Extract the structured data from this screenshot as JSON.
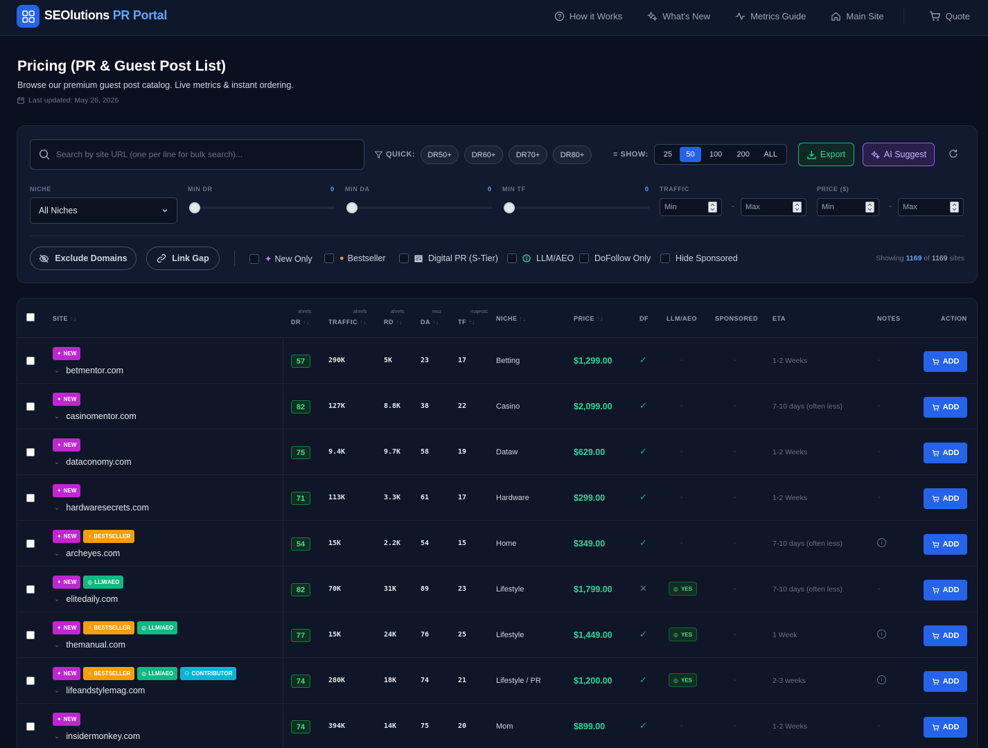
{
  "nav": {
    "brand_main": "SEOlutions",
    "brand_accent": "PR Portal",
    "links": [
      "How it Works",
      "What's New",
      "Metrics Guide",
      "Main Site"
    ],
    "quote": "Quote"
  },
  "header": {
    "title": "Pricing (PR & Guest Post List)",
    "subtitle": "Browse our premium guest post catalog. Live metrics & instant ordering.",
    "updated": "Last updated: May 26, 2026"
  },
  "filters": {
    "search_placeholder": "Search by site URL (one per line for bulk search)...",
    "quick_label": "QUICK:",
    "quick_pills": [
      "DR50+",
      "DR60+",
      "DR70+",
      "DR80+"
    ],
    "show_label": "SHOW:",
    "show_options": [
      "25",
      "50",
      "100",
      "200",
      "ALL"
    ],
    "show_selected": "50",
    "export_label": "Export",
    "ai_label": "AI Suggest",
    "niche_label": "NICHE",
    "niche_value": "All Niches",
    "min_dr_label": "MIN DR",
    "min_dr_value": "0",
    "min_da_label": "MIN DA",
    "min_da_value": "0",
    "min_tf_label": "MIN TF",
    "min_tf_value": "0",
    "traffic_label": "TRAFFIC",
    "price_label": "PRICE ($)",
    "min_placeholder": "Min",
    "max_placeholder": "Max",
    "range_sep": "-",
    "exclude_label": "Exclude Domains",
    "linkgap_label": "Link Gap",
    "checkboxes": [
      "New Only",
      "Bestseller",
      "Digital PR (S-Tier)",
      "LLM/AEO",
      "DoFollow Only",
      "Hide Sponsored"
    ],
    "showing_prefix": "Showing",
    "showing_count": "1169",
    "showing_of": "of",
    "showing_total": "1169",
    "showing_suffix": "sites"
  },
  "table": {
    "headers": {
      "site": "SITE",
      "dr": "DR",
      "dr_src": "ahrefs",
      "traffic": "TRAFFIC",
      "traffic_src": "ahrefs",
      "rd": "RD",
      "rd_src": "ahrefs",
      "da": "DA",
      "da_src": "moz",
      "tf": "TF",
      "tf_src": "majestic",
      "niche": "NICHE",
      "price": "PRICE",
      "df": "DF",
      "llm": "LLM/AEO",
      "sponsored": "SPONSORED",
      "eta": "ETA",
      "notes": "NOTES",
      "action": "ACTION"
    },
    "sort_glyph": "↑↓",
    "add_label": "ADD",
    "yes_label": "YES",
    "dash": "-",
    "rows": [
      {
        "badges": [
          "NEW"
        ],
        "site": "betmentor.com",
        "dr": "57",
        "traffic": "290K",
        "rd": "5K",
        "da": "23",
        "tf": "17",
        "niche": "Betting",
        "price": "$1,299.00",
        "df": true,
        "llm": false,
        "eta": "1-2 Weeks",
        "note": false
      },
      {
        "badges": [
          "NEW"
        ],
        "site": "casinomentor.com",
        "dr": "82",
        "traffic": "127K",
        "rd": "8.8K",
        "da": "38",
        "tf": "22",
        "niche": "Casino",
        "price": "$2,099.00",
        "df": true,
        "llm": false,
        "eta": "7-10 days (often less)",
        "note": false
      },
      {
        "badges": [
          "NEW"
        ],
        "site": "dataconomy.com",
        "dr": "75",
        "traffic": "9.4K",
        "rd": "9.7K",
        "da": "58",
        "tf": "19",
        "niche": "Dataw",
        "price": "$629.00",
        "df": true,
        "llm": false,
        "eta": "1-2 Weeks",
        "note": false
      },
      {
        "badges": [
          "NEW"
        ],
        "site": "hardwaresecrets.com",
        "dr": "71",
        "traffic": "113K",
        "rd": "3.3K",
        "da": "61",
        "tf": "17",
        "niche": "Hardware",
        "price": "$299.00",
        "df": true,
        "llm": false,
        "eta": "1-2 Weeks",
        "note": false
      },
      {
        "badges": [
          "NEW",
          "BESTSELLER"
        ],
        "site": "archeyes.com",
        "dr": "54",
        "traffic": "15K",
        "rd": "2.2K",
        "da": "54",
        "tf": "15",
        "niche": "Home",
        "price": "$349.00",
        "df": true,
        "llm": false,
        "eta": "7-10 days (often less)",
        "note": true
      },
      {
        "badges": [
          "NEW",
          "LLM/AEO"
        ],
        "site": "elitedaily.com",
        "dr": "82",
        "traffic": "70K",
        "rd": "31K",
        "da": "89",
        "tf": "23",
        "niche": "Lifestyle",
        "price": "$1,799.00",
        "df": false,
        "llm": true,
        "eta": "7-10 days (often less)",
        "note": false
      },
      {
        "badges": [
          "NEW",
          "BESTSELLER",
          "LLM/AEO"
        ],
        "site": "themanual.com",
        "dr": "77",
        "traffic": "15K",
        "rd": "24K",
        "da": "76",
        "tf": "25",
        "niche": "Lifestyle",
        "price": "$1,449.00",
        "df": true,
        "llm": true,
        "eta": "1 Week",
        "note": true
      },
      {
        "badges": [
          "NEW",
          "BESTSELLER",
          "LLM/AEO",
          "CONTRIBUTOR"
        ],
        "site": "lifeandstylemag.com",
        "dr": "74",
        "traffic": "280K",
        "rd": "18K",
        "da": "74",
        "tf": "21",
        "niche": "Lifestyle / PR",
        "price": "$1,200.00",
        "df": true,
        "llm": true,
        "eta": "2-3 weeks",
        "note": true
      },
      {
        "badges": [
          "NEW"
        ],
        "site": "insidermonkey.com",
        "dr": "74",
        "traffic": "394K",
        "rd": "14K",
        "da": "75",
        "tf": "20",
        "niche": "Mom",
        "price": "$899.00",
        "df": true,
        "llm": false,
        "eta": "1-2 Weeks",
        "note": false
      }
    ]
  },
  "colors": {
    "background": "#0b1020",
    "accent": "#2563eb",
    "price": "#34d399",
    "new_badge": "#c026d3",
    "bestseller_badge": "#f59e0b",
    "llm_badge": "#10b981",
    "contributor_badge": "#06b6d4"
  }
}
